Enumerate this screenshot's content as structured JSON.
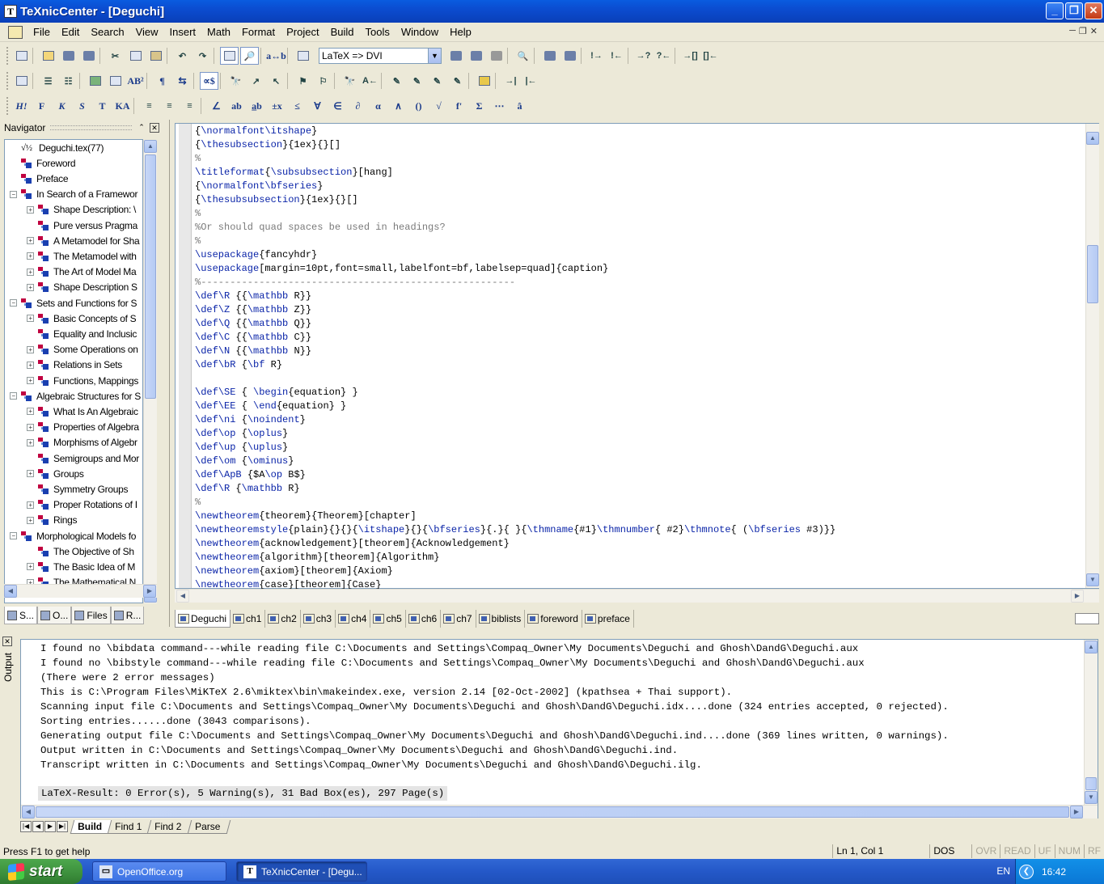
{
  "window": {
    "title": "TeXnicCenter - [Deguchi]",
    "icon_letter": "T"
  },
  "menu": [
    "File",
    "Edit",
    "Search",
    "View",
    "Insert",
    "Math",
    "Format",
    "Project",
    "Build",
    "Tools",
    "Window",
    "Help"
  ],
  "toolbar": {
    "build_profile": "LaTeX => DVI"
  },
  "navigator": {
    "title": "Navigator",
    "items": [
      {
        "label": "Deguchi.tex(77)",
        "depth": 0,
        "expander": "none"
      },
      {
        "label": "Foreword",
        "depth": 1,
        "expander": "none"
      },
      {
        "label": "Preface",
        "depth": 1,
        "expander": "none"
      },
      {
        "label": "In Search of a Framewor",
        "depth": 1,
        "expander": "minus"
      },
      {
        "label": "Shape Description: \\",
        "depth": 2,
        "expander": "plus"
      },
      {
        "label": "Pure versus Pragma",
        "depth": 2,
        "expander": "none"
      },
      {
        "label": "A Metamodel for Sha",
        "depth": 2,
        "expander": "plus"
      },
      {
        "label": "The Metamodel with",
        "depth": 2,
        "expander": "plus"
      },
      {
        "label": "The Art of Model Ma",
        "depth": 2,
        "expander": "plus"
      },
      {
        "label": "Shape Description S",
        "depth": 2,
        "expander": "plus"
      },
      {
        "label": "Sets and Functions for S",
        "depth": 1,
        "expander": "minus"
      },
      {
        "label": "Basic Concepts of S",
        "depth": 2,
        "expander": "plus"
      },
      {
        "label": "Equality and Inclusic",
        "depth": 2,
        "expander": "none"
      },
      {
        "label": "Some Operations on",
        "depth": 2,
        "expander": "plus"
      },
      {
        "label": "Relations in Sets",
        "depth": 2,
        "expander": "plus"
      },
      {
        "label": "Functions, Mappings",
        "depth": 2,
        "expander": "plus"
      },
      {
        "label": "Algebraic Structures for S",
        "depth": 1,
        "expander": "minus"
      },
      {
        "label": "What Is An Algebraic",
        "depth": 2,
        "expander": "plus"
      },
      {
        "label": "Properties of Algebra",
        "depth": 2,
        "expander": "plus"
      },
      {
        "label": "Morphisms of Algebr",
        "depth": 2,
        "expander": "plus"
      },
      {
        "label": "Semigroups and Mor",
        "depth": 2,
        "expander": "none"
      },
      {
        "label": "Groups",
        "depth": 2,
        "expander": "plus"
      },
      {
        "label": "Symmetry Groups",
        "depth": 2,
        "expander": "none"
      },
      {
        "label": "Proper Rotations of I",
        "depth": 2,
        "expander": "plus"
      },
      {
        "label": "Rings",
        "depth": 2,
        "expander": "plus"
      },
      {
        "label": "Morphological Models fo",
        "depth": 1,
        "expander": "minus"
      },
      {
        "label": "The Objective of Sh",
        "depth": 2,
        "expander": "none"
      },
      {
        "label": "The Basic Idea of M",
        "depth": 2,
        "expander": "plus"
      },
      {
        "label": "The Mathematical N",
        "depth": 2,
        "expander": "plus"
      }
    ],
    "tabs": [
      "S...",
      "O...",
      "Files",
      "R..."
    ]
  },
  "editor": {
    "lines": [
      "{\\normalfont\\itshape}",
      "{\\thesubsection}{1ex}{}[]",
      "%",
      "\\titleformat{\\subsubsection}[hang]",
      "{\\normalfont\\bfseries}",
      "{\\thesubsubsection}{1ex}{}[]",
      "%",
      "%Or should quad spaces be used in headings?",
      "%",
      "\\usepackage{fancyhdr}",
      "\\usepackage[margin=10pt,font=small,labelfont=bf,labelsep=quad]{caption}",
      "%------------------------------------------------------",
      "\\def\\R {{\\mathbb R}}",
      "\\def\\Z {{\\mathbb Z}}",
      "\\def\\Q {{\\mathbb Q}}",
      "\\def\\C {{\\mathbb C}}",
      "\\def\\N {{\\mathbb N}}",
      "\\def\\bR {\\bf R}",
      "",
      "\\def\\SE { \\begin{equation} }",
      "\\def\\EE { \\end{equation} }",
      "\\def\\ni {\\noindent}",
      "\\def\\op {\\oplus}",
      "\\def\\up {\\uplus}",
      "\\def\\om {\\ominus}",
      "\\def\\ApB {$A\\op B$}",
      "\\def\\R {\\mathbb R}",
      "%",
      "\\newtheorem{theorem}{Theorem}[chapter]",
      "\\newtheoremstyle{plain}{}{}{\\itshape}{}{\\bfseries}{.}{ }{\\thmname{#1}\\thmnumber{ #2}\\thmnote{ (\\bfseries #3)}}",
      "\\newtheorem{acknowledgement}[theorem]{Acknowledgement}",
      "\\newtheorem{algorithm}[theorem]{Algorithm}",
      "\\newtheorem{axiom}[theorem]{Axiom}",
      "\\newtheorem{case}[theorem]{Case}"
    ],
    "tabs": [
      "Deguchi",
      "ch1",
      "ch2",
      "ch3",
      "ch4",
      "ch5",
      "ch6",
      "ch7",
      "biblists",
      "foreword",
      "preface"
    ]
  },
  "output": {
    "title": "Output",
    "lines": [
      "I found no \\bibdata command---while reading file C:\\Documents and Settings\\Compaq_Owner\\My Documents\\Deguchi and Ghosh\\DandG\\Deguchi.aux",
      "I found no \\bibstyle command---while reading file C:\\Documents and Settings\\Compaq_Owner\\My Documents\\Deguchi and Ghosh\\DandG\\Deguchi.aux",
      "(There were 2 error messages)",
      "This is C:\\Program Files\\MiKTeX 2.6\\miktex\\bin\\makeindex.exe, version 2.14 [02-Oct-2002] (kpathsea + Thai support).",
      "Scanning input file C:\\Documents and Settings\\Compaq_Owner\\My Documents\\Deguchi and Ghosh\\DandG\\Deguchi.idx....done (324 entries accepted, 0 rejected).",
      "Sorting entries......done (3043 comparisons).",
      "Generating output file C:\\Documents and Settings\\Compaq_Owner\\My Documents\\Deguchi and Ghosh\\DandG\\Deguchi.ind....done (369 lines written, 0 warnings).",
      "Output written in C:\\Documents and Settings\\Compaq_Owner\\My Documents\\Deguchi and Ghosh\\DandG\\Deguchi.ind.",
      "Transcript written in C:\\Documents and Settings\\Compaq_Owner\\My Documents\\Deguchi and Ghosh\\DandG\\Deguchi.ilg."
    ],
    "result": "LaTeX-Result: 0 Error(s), 5 Warning(s), 31 Bad Box(es), 297 Page(s)",
    "tabs": [
      "Build",
      "Find 1",
      "Find 2",
      "Parse"
    ]
  },
  "statusbar": {
    "help": "Press F1 to get help",
    "position": "Ln 1, Col 1",
    "format": "DOS",
    "indicators": [
      "OVR",
      "READ",
      "UF",
      "NUM",
      "RF"
    ]
  },
  "taskbar": {
    "start": "start",
    "buttons": [
      "OpenOffice.org",
      "TeXnicCenter - [Degu..."
    ],
    "lang": "EN",
    "clock": "16:42"
  }
}
